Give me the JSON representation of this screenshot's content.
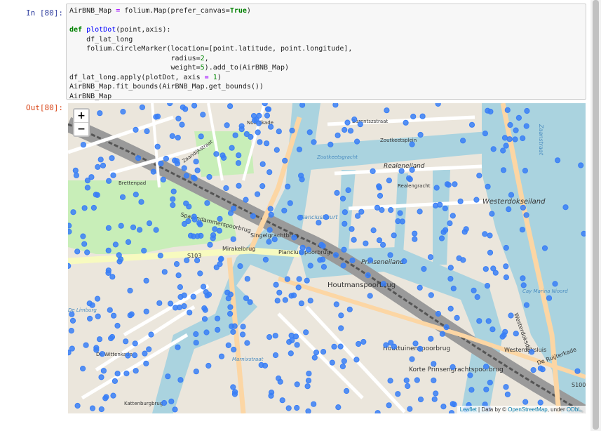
{
  "cells": {
    "input_prompt": "In [80]:",
    "output_prompt": "Out[80]:"
  },
  "code_lines": [
    "AirBNB_Map = folium.Map(prefer_canvas=True)",
    "",
    "def plotDot(point,axis):",
    "    df_lat_long",
    "    folium.CircleMarker(location=[point.latitude, point.longitude],",
    "                        radius=2,",
    "                        weight=5).add_to(AirBNB_Map)",
    "df_lat_long.apply(plotDot, axis = 1)",
    "AirBNB_Map.fit_bounds(AirBNB_Map.get_bounds())",
    "AirBNB_Map"
  ],
  "map": {
    "zoom_in": "+",
    "zoom_out": "−",
    "attribution": {
      "leaflet": "Leaflet",
      "sep": " | Data by © ",
      "osm": "OpenStreetMap",
      "tail": ", under ",
      "license": "ODbL."
    },
    "marker_color": "#3a7ff6",
    "labels": {
      "westerdokseiland": "Westerdokseiland",
      "realeneiland": "Realeneiland",
      "prinseneiland": "Prinseneiland",
      "houtmanspoorbrug": "Houtmanspoorbrug",
      "houttuinenspoorbrug": "Houttuinenspoorbrug",
      "korte_prinsengracht": "Korte Prinsengrachtspoorbrug",
      "singelgrachtbrug": "Singelgrachtbrug",
      "planciusspoorbrug": "Planciusspoorbrug",
      "spaarndammerspoorbrug": "Spaarndammerspoorbrug",
      "mirakelbrug": "Mirakelbrug",
      "westerdoksluis": "Westerdoksluis",
      "westerdoksdijk": "Westerdoksdijk",
      "de_ruijterkade": "De Ruijterkade",
      "s103": "S103",
      "s100": "S100",
      "brettenpad": "Brettenpad",
      "zoutkeetsgracht": "Zoutkeetsgracht",
      "zoutkeetsplein": "Zoutkeetsplein",
      "planciusbuurt": "Planciusbuurt",
      "barentszstraat": "Barentszstraat",
      "realengracht": "Realengracht",
      "zaandijkstraat": "Zaandijkstraat",
      "noordkade": "Noordkade",
      "cay_marina": "Cay Marina Nioord",
      "de_wittenkade": "De Wittenkade",
      "de_limburg": "De Limburg",
      "kattenburgbrug": "Kattenburgbrug",
      "marnixstraat": "Marnixstraat",
      "ij": "Zaanstraat"
    }
  }
}
